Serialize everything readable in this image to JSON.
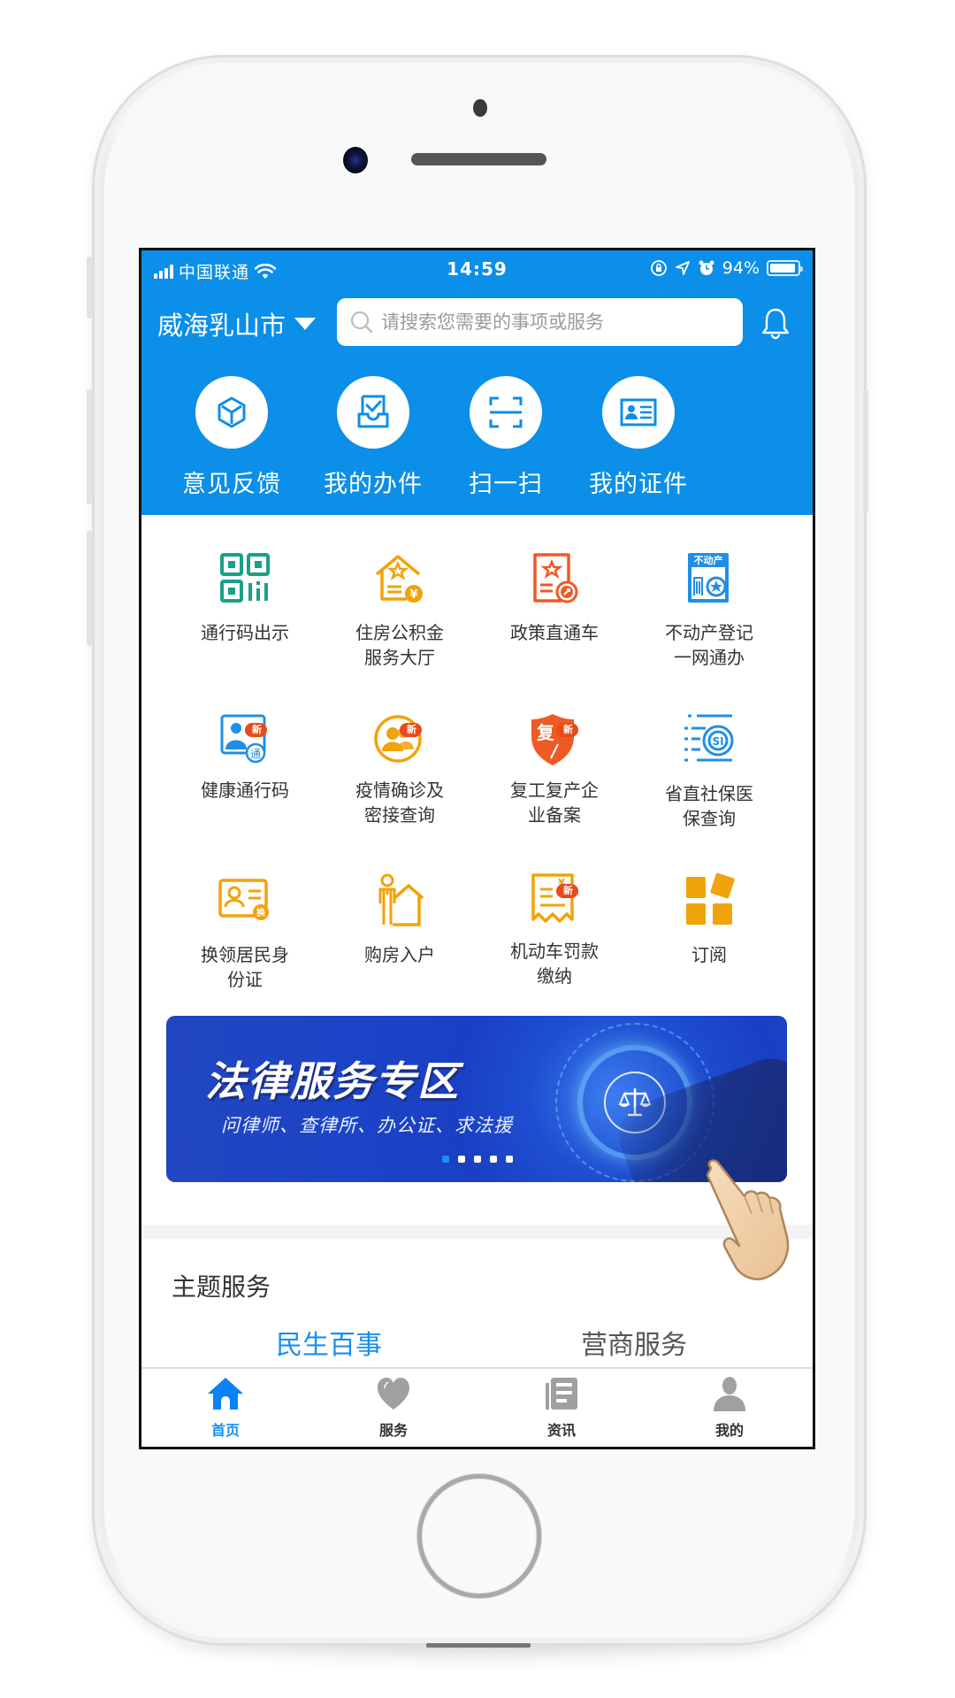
{
  "status_bar": {
    "carrier": "中国联通",
    "time": "14:59",
    "battery_percent": "94%",
    "battery_level": 0.94,
    "icons": [
      "signal-icon",
      "wifi-icon",
      "orientation-lock-icon",
      "location-icon",
      "alarm-icon",
      "battery-icon"
    ]
  },
  "header": {
    "city": "威海乳山市",
    "search_placeholder": "请搜索您需要的事项或服务",
    "search_value": "",
    "icons": {
      "search": "search-icon",
      "bell": "bell-icon",
      "city_dropdown": "caret-down-icon"
    }
  },
  "quick_actions": [
    {
      "label": "意见反馈",
      "icon": "cube-icon"
    },
    {
      "label": "我的办件",
      "icon": "inbox-check-icon"
    },
    {
      "label": "扫一扫",
      "icon": "scan-icon"
    },
    {
      "label": "我的证件",
      "icon": "id-card-icon"
    }
  ],
  "services": [
    {
      "line1": "通行码出示",
      "line2": "",
      "icon": "qr-code-icon",
      "color": "#1aa08a",
      "badge": ""
    },
    {
      "line1": "住房公积金",
      "line2": "服务大厅",
      "icon": "house-fund-icon",
      "color": "#f0a30a",
      "badge": ""
    },
    {
      "line1": "政策直通车",
      "line2": "",
      "icon": "policy-document-icon",
      "color": "#ee5a24",
      "badge": ""
    },
    {
      "line1": "不动产登记",
      "line2": "一网通办",
      "icon": "real-estate-icon",
      "color": "#1e8fe6",
      "badge": "",
      "icon_text": "不动产"
    },
    {
      "line1": "健康通行码",
      "line2": "",
      "icon": "health-code-icon",
      "color": "#1e8fe6",
      "badge": "新",
      "icon_text": "通"
    },
    {
      "line1": "疫情确诊及",
      "line2": "密接查询",
      "icon": "epidemic-query-icon",
      "color": "#f0a30a",
      "badge": "新"
    },
    {
      "line1": "复工复产企",
      "line2": "业备案",
      "icon": "resume-work-shield-icon",
      "color": "#ee5a24",
      "badge": "新",
      "icon_text": "复"
    },
    {
      "line1": "省直社保医",
      "line2": "保查询",
      "icon": "social-security-icon",
      "color": "#1e8fe6",
      "badge": ""
    },
    {
      "line1": "换领居民身",
      "line2": "份证",
      "icon": "id-renewal-icon",
      "color": "#f0a30a",
      "badge": "",
      "icon_text": "换"
    },
    {
      "line1": "购房入户",
      "line2": "",
      "icon": "home-purchase-icon",
      "color": "#f0a30a",
      "badge": ""
    },
    {
      "line1": "机动车罚款",
      "line2": "缴纳",
      "icon": "vehicle-fine-receipt-icon",
      "color": "#f0a30a",
      "badge": "新"
    },
    {
      "line1": "订阅",
      "line2": "",
      "icon": "subscribe-grid-icon",
      "color": "#f0a30a",
      "badge": ""
    }
  ],
  "banner": {
    "title": "法律服务专区",
    "subtitle": "问律师、查律所、办公证、求法援",
    "slide_count": 5,
    "active_slide": 1,
    "icon": "scales-of-justice-icon"
  },
  "topic_section": {
    "title": "主题服务",
    "tabs": [
      {
        "label": "民生百事",
        "active": true
      },
      {
        "label": "营商服务",
        "active": false
      }
    ]
  },
  "tab_bar": [
    {
      "label": "首页",
      "icon": "home-icon",
      "active": true
    },
    {
      "label": "服务",
      "icon": "heart-icon",
      "active": false
    },
    {
      "label": "资讯",
      "icon": "news-icon",
      "active": false
    },
    {
      "label": "我的",
      "icon": "user-icon",
      "active": false
    }
  ],
  "colors": {
    "brand_blue": "#0b8fe8",
    "active_blue": "#1a8fee",
    "badge_red": "#e94a1c",
    "inactive_gray": "#a0a0a0"
  }
}
